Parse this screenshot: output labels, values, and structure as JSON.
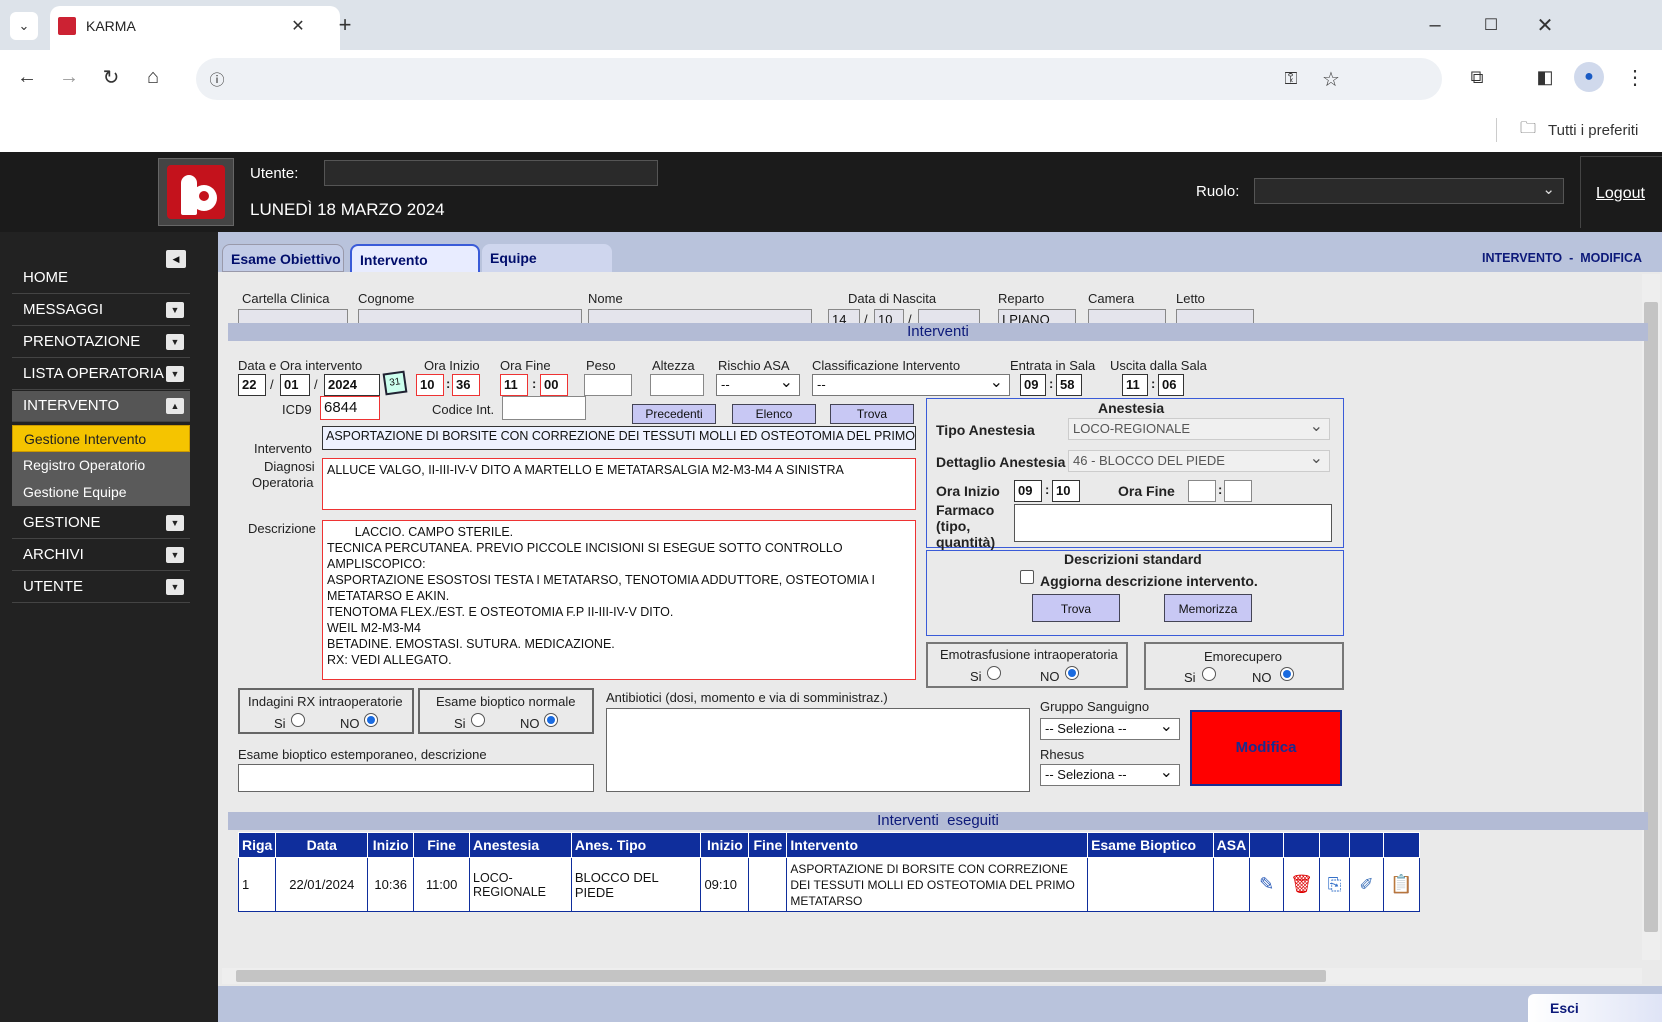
{
  "browser": {
    "tab_title": "KARMA",
    "new_tab": "+",
    "bookmarks_label": "Tutti i preferiti"
  },
  "header": {
    "user_label": "Utente:",
    "date": "LUNEDÌ 18 MARZO 2024",
    "role_label": "Ruolo:",
    "logout": "Logout"
  },
  "sidebar": {
    "items": [
      {
        "label": "HOME"
      },
      {
        "label": "MESSAGGI"
      },
      {
        "label": "PRENOTAZIONE"
      },
      {
        "label": "LISTA OPERATORIA"
      },
      {
        "label": "INTERVENTO"
      },
      {
        "label": "GESTIONE"
      },
      {
        "label": "ARCHIVI"
      },
      {
        "label": "UTENTE"
      }
    ],
    "subitems": [
      {
        "label": "Gestione Intervento"
      },
      {
        "label": "Registro Operatorio"
      },
      {
        "label": "Gestione Equipe"
      }
    ]
  },
  "tabs": [
    "Esame Obiettivo",
    "Intervento",
    "Equipe"
  ],
  "mode_label": "INTERVENTO  -  MODIFICA",
  "patient": {
    "labels": [
      "Cartella Clinica",
      "Cognome",
      "Nome",
      "Data di Nascita",
      "Reparto",
      "Camera",
      "Letto"
    ],
    "birth_day": "14",
    "birth_month": "10",
    "reparto": "I PIANO",
    "camera": "_ _ _"
  },
  "section_interventi": "Interventi",
  "section_eseguiti": "Interventi  eseguiti",
  "intervento": {
    "labels": {
      "data_ora": "Data e Ora intervento",
      "ora_inizio": "Ora Inizio",
      "ora_fine": "Ora Fine",
      "peso": "Peso",
      "altezza": "Altezza",
      "rischio": "Rischio ASA",
      "classificazione": "Classificazione Intervento",
      "entrata": "Entrata in Sala",
      "uscita": "Uscita dalla Sala",
      "icd9": "ICD9",
      "codice": "Codice Int.",
      "intervento": "Intervento",
      "diagnosi": "Diagnosi",
      "operatoria": "Operatoria",
      "descrizione": "Descrizione"
    },
    "day": "22",
    "month": "01",
    "year": "2024",
    "start_h": "10",
    "start_m": "36",
    "end_h": "11",
    "end_m": "00",
    "rischio": "--",
    "classificazione": "--",
    "entrata_h": "09",
    "entrata_m": "58",
    "uscita_h": "11",
    "uscita_m": "06",
    "icd9": "6844",
    "intervento_text": "ASPORTAZIONE DI BORSITE CON CORREZIONE DEI TESSUTI MOLLI ED OSTEOTOMIA DEL PRIMO ME",
    "diagnosi_text": "ALLUCE VALGO, II-III-IV-V DITO A MARTELLO E METATARSALGIA M2-M3-M4 A SINISTRA",
    "descrizione_text": "        LACCIO. CAMPO STERILE.\nTECNICA PERCUTANEA. PREVIO PICCOLE INCISIONI SI ESEGUE SOTTO CONTROLLO\nAMPLISCOPICO:\nASPORTAZIONE ESOSTOSI TESTA I METATARSO, TENOTOMIA ADDUTTORE, OSTEOTOMIA I\nMETATARSO E AKIN.\nTENOTOMA FLEX./EST. E OSTEOTOMIA F.P II-III-IV-V DITO.\nWEIL M2-M3-M4\nBETADINE. EMOSTASI. SUTURA. MEDICAZIONE.\nRX: VEDI ALLEGATO.",
    "buttons": {
      "precedenti": "Precedenti",
      "elenco": "Elenco",
      "trova": "Trova"
    }
  },
  "anestesia": {
    "title": "Anestesia",
    "tipo_label": "Tipo Anestesia",
    "tipo_value": "LOCO-REGIONALE",
    "dettaglio_label": "Dettaglio Anestesia",
    "dettaglio_value": "46 - BLOCCO DEL PIEDE",
    "ora_inizio_label": "Ora Inizio",
    "ora_inizio_h": "09",
    "ora_inizio_m": "10",
    "ora_fine_label": "Ora Fine",
    "farmaco_label": "Farmaco\n(tipo,\nquantità)"
  },
  "desc_std": {
    "title": "Descrizioni standard",
    "checkbox": "Aggiorna descrizione intervento.",
    "trova": "Trova",
    "memorizza": "Memorizza"
  },
  "emotrasfusione": {
    "title": "Emotrasfusione intraoperatoria",
    "si": "Si",
    "no": "NO"
  },
  "emorecupero": {
    "title": "Emorecupero",
    "si": "Si",
    "no": "NO"
  },
  "indagini": {
    "title": "Indagini RX intraoperatorie",
    "si": "Si",
    "no": "NO"
  },
  "bioptico": {
    "title": "Esame bioptico normale",
    "si": "Si",
    "no": "NO"
  },
  "antibiotici_label": "Antibiotici (dosi, momento e via di somministraz.)",
  "estemporaneo_label": "Esame bioptico estemporaneo, descrizione",
  "gruppo": {
    "label": "Gruppo Sanguigno",
    "value": "-- Seleziona --"
  },
  "rhesus": {
    "label": "Rhesus",
    "value": "-- Seleziona --"
  },
  "modifica": "Modifica",
  "table": {
    "headers": [
      "Riga",
      "Data",
      "Inizio",
      "Fine",
      "Anestesia",
      "Anes. Tipo",
      "Inizio",
      "Fine",
      "Intervento",
      "Esame Bioptico",
      "ASA"
    ],
    "rows": [
      {
        "riga": "1",
        "data": "22/01/2024",
        "inizio": "10:36",
        "fine": "11:00",
        "anestesia": "LOCO-\nREGIONALE",
        "tipo": "BLOCCO DEL PIEDE",
        "an_inizio": "09:10",
        "an_fine": "",
        "intervento": "ASPORTAZIONE DI BORSITE CON CORREZIONE DEI TESSUTI MOLLI ED OSTEOTOMIA DEL PRIMO METATARSO",
        "bioptico": "",
        "asa": ""
      }
    ]
  },
  "footer": {
    "esci": "Esci"
  },
  "colors": {
    "accent_blue": "#0f2e9c",
    "modifica_bg": "#ff0000",
    "highlight": "#f5c400"
  }
}
